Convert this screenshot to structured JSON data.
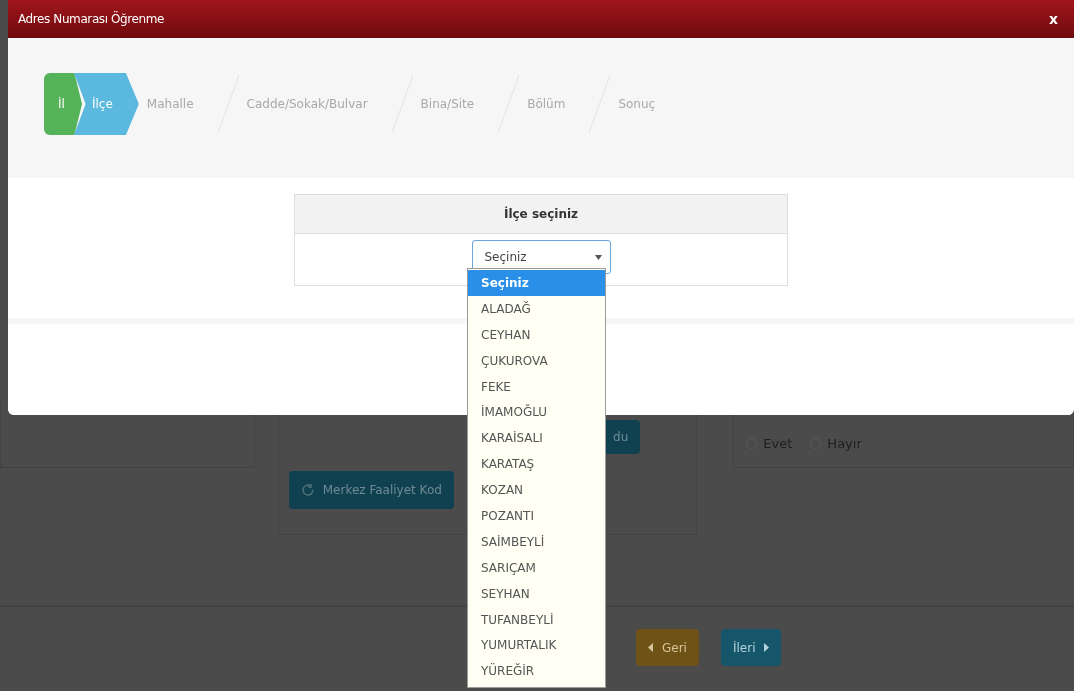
{
  "modal": {
    "title": "Adres Numarası Öğrenme",
    "close": "x",
    "steps": [
      {
        "label": "İl",
        "selected": false
      },
      {
        "label": "İlçe",
        "selected": true
      },
      {
        "label": "Mahalle",
        "selected": false
      },
      {
        "label": "Cadde/Sokak/Bulvar",
        "selected": false
      },
      {
        "label": "Bina/Site",
        "selected": false
      },
      {
        "label": "Bölüm",
        "selected": false
      },
      {
        "label": "Sonuç",
        "selected": false
      }
    ],
    "panel": {
      "heading": "İlçe seçiniz",
      "select": {
        "value": "Seçiniz",
        "expanded": true,
        "options": [
          {
            "label": "Seçiniz",
            "selected": true
          },
          {
            "label": "ALADAĞ",
            "selected": false
          },
          {
            "label": "CEYHAN",
            "selected": false
          },
          {
            "label": "ÇUKUROVA",
            "selected": false
          },
          {
            "label": "FEKE",
            "selected": false
          },
          {
            "label": "İMAMOĞLU",
            "selected": false
          },
          {
            "label": "KARAİSALI",
            "selected": false
          },
          {
            "label": "KARATAŞ",
            "selected": false
          },
          {
            "label": "KOZAN",
            "selected": false
          },
          {
            "label": "POZANTI",
            "selected": false
          },
          {
            "label": "SAİMBEYLİ",
            "selected": false
          },
          {
            "label": "SARIÇAM",
            "selected": false
          },
          {
            "label": "SEYHAN",
            "selected": false
          },
          {
            "label": "TUFANBEYLİ",
            "selected": false
          },
          {
            "label": "YUMURTALIK",
            "selected": false
          },
          {
            "label": "YÜREĞİR",
            "selected": false
          }
        ]
      }
    }
  },
  "background": {
    "hidden_button": "du",
    "activity_button": "Merkez Faaliyet Kod",
    "radios": [
      {
        "label": "Evet",
        "selected": false
      },
      {
        "label": "Hayır",
        "selected": false
      }
    ],
    "back_button": "Geri",
    "next_button": "İleri"
  }
}
